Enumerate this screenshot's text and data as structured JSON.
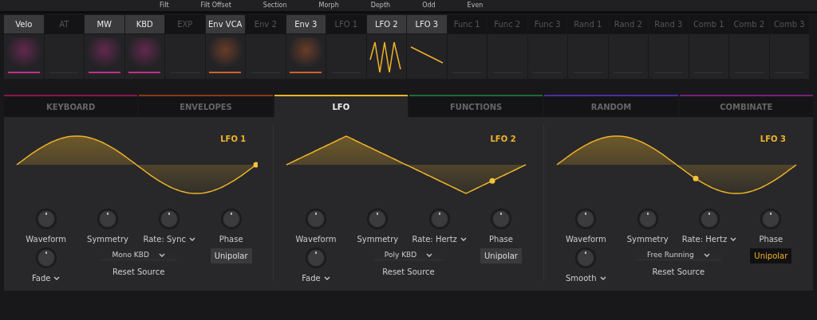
{
  "top_strip": {
    "labels": [
      "Filt",
      "Filt Offset",
      "Section",
      "Morph",
      "Depth",
      "Odd",
      "Even"
    ]
  },
  "sources": [
    {
      "label": "Velo",
      "selected": true,
      "kind": "bar",
      "color": "#c0308a"
    },
    {
      "label": "AT",
      "selected": false,
      "kind": "none"
    },
    {
      "label": "MW",
      "selected": true,
      "kind": "bar",
      "color": "#c0308a"
    },
    {
      "label": "KBD",
      "selected": true,
      "kind": "bar",
      "color": "#c0308a"
    },
    {
      "label": "EXP",
      "selected": false,
      "kind": "none"
    },
    {
      "label": "Env VCA",
      "selected": true,
      "kind": "bar",
      "color": "#d0622a"
    },
    {
      "label": "Env 2",
      "selected": false,
      "kind": "none"
    },
    {
      "label": "Env 3",
      "selected": true,
      "kind": "bar",
      "color": "#d0622a"
    },
    {
      "label": "LFO 1",
      "selected": false,
      "kind": "none"
    },
    {
      "label": "LFO 2",
      "selected": true,
      "kind": "zigzag",
      "color": "#f0b429"
    },
    {
      "label": "LFO 3",
      "selected": true,
      "kind": "slope",
      "color": "#f0b429"
    },
    {
      "label": "Func 1",
      "selected": false,
      "kind": "none"
    },
    {
      "label": "Func 2",
      "selected": false,
      "kind": "none"
    },
    {
      "label": "Func 3",
      "selected": false,
      "kind": "none"
    },
    {
      "label": "Rand 1",
      "selected": false,
      "kind": "none"
    },
    {
      "label": "Rand 2",
      "selected": false,
      "kind": "none"
    },
    {
      "label": "Rand 3",
      "selected": false,
      "kind": "none"
    },
    {
      "label": "Comb 1",
      "selected": false,
      "kind": "none"
    },
    {
      "label": "Comb 2",
      "selected": false,
      "kind": "none"
    },
    {
      "label": "Comb 3",
      "selected": false,
      "kind": "none"
    }
  ],
  "tabs": [
    {
      "label": "KEYBOARD",
      "color": "#8a1448",
      "selected": false
    },
    {
      "label": "ENVELOPES",
      "color": "#8a3a12",
      "selected": false
    },
    {
      "label": "LFO",
      "color": "#f0b429",
      "selected": true
    },
    {
      "label": "FUNCTIONS",
      "color": "#1e6b35",
      "selected": false
    },
    {
      "label": "RANDOM",
      "color": "#4a2fa0",
      "selected": false
    },
    {
      "label": "COMBINATE",
      "color": "#7a1e7a",
      "selected": false
    }
  ],
  "lfos": [
    {
      "title": "LFO 1",
      "kind": "sine",
      "playhead": {
        "level": 1.0
      },
      "knobs": [
        {
          "label": "Waveform",
          "dropdown": false
        },
        {
          "label": "Symmetry",
          "dropdown": false
        },
        {
          "label": "Rate: Sync",
          "dropdown": true
        },
        {
          "label": "Phase",
          "dropdown": false
        }
      ],
      "extra_knob": {
        "label": "Fade"
      },
      "reset_source": {
        "value": "Mono KBD",
        "label": "Reset Source"
      },
      "unipolar": {
        "label": "Unipolar",
        "on": false
      }
    },
    {
      "title": "LFO 2",
      "kind": "triangle",
      "playhead": {
        "level": 0.86
      },
      "knobs": [
        {
          "label": "Waveform",
          "dropdown": false
        },
        {
          "label": "Symmetry",
          "dropdown": false
        },
        {
          "label": "Rate: Hertz",
          "dropdown": true
        },
        {
          "label": "Phase",
          "dropdown": false
        }
      ],
      "extra_knob": {
        "label": "Fade"
      },
      "reset_source": {
        "value": "Poly KBD",
        "label": "Reset Source"
      },
      "unipolar": {
        "label": "Unipolar",
        "on": false
      }
    },
    {
      "title": "LFO 3",
      "kind": "sine",
      "playhead": {
        "level": 0.58
      },
      "knobs": [
        {
          "label": "Waveform",
          "dropdown": false
        },
        {
          "label": "Symmetry",
          "dropdown": false
        },
        {
          "label": "Rate: Hertz",
          "dropdown": true
        },
        {
          "label": "Phase",
          "dropdown": false
        }
      ],
      "extra_knob": {
        "label": "Smooth"
      },
      "reset_source": {
        "value": "Free Running",
        "label": "Reset Source"
      },
      "unipolar": {
        "label": "Unipolar",
        "on": true
      }
    }
  ]
}
